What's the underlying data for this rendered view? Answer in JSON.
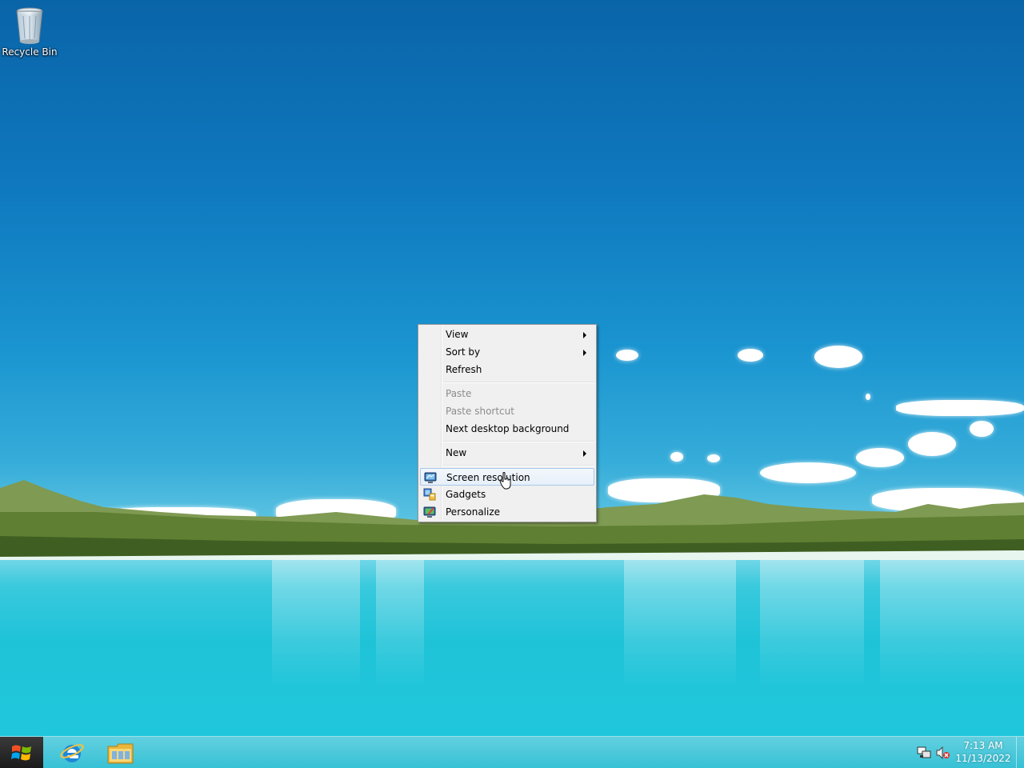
{
  "desktop": {
    "icons": [
      {
        "label": "Recycle Bin",
        "icon": "recycle-bin-icon"
      }
    ]
  },
  "context_menu": {
    "items": [
      {
        "label": "View",
        "submenu": true,
        "enabled": true
      },
      {
        "label": "Sort by",
        "submenu": true,
        "enabled": true
      },
      {
        "label": "Refresh",
        "submenu": false,
        "enabled": true
      },
      {
        "label": "Paste",
        "submenu": false,
        "enabled": false
      },
      {
        "label": "Paste shortcut",
        "submenu": false,
        "enabled": false
      },
      {
        "label": "Next desktop background",
        "submenu": false,
        "enabled": true
      },
      {
        "label": "New",
        "submenu": true,
        "enabled": true
      },
      {
        "label": "Screen resolution",
        "submenu": false,
        "enabled": true,
        "icon": "screen-resolution-icon",
        "highlighted": true
      },
      {
        "label": "Gadgets",
        "submenu": false,
        "enabled": true,
        "icon": "gadgets-icon"
      },
      {
        "label": "Personalize",
        "submenu": false,
        "enabled": true,
        "icon": "personalize-icon"
      }
    ]
  },
  "taskbar": {
    "start_icon": "windows-logo-icon",
    "pinned": [
      {
        "icon": "internet-explorer-icon"
      },
      {
        "icon": "file-explorer-icon"
      }
    ],
    "tray": {
      "icons": [
        "network-icon",
        "volume-muted-icon"
      ],
      "time": "7:13 AM",
      "date": "11/13/2022"
    }
  },
  "colors": {
    "menu_bg": "#f0f0f0",
    "menu_highlight_border": "#a8c8eb",
    "disabled_text": "#8c8c8c",
    "taskbar": "#4cc3d6"
  }
}
